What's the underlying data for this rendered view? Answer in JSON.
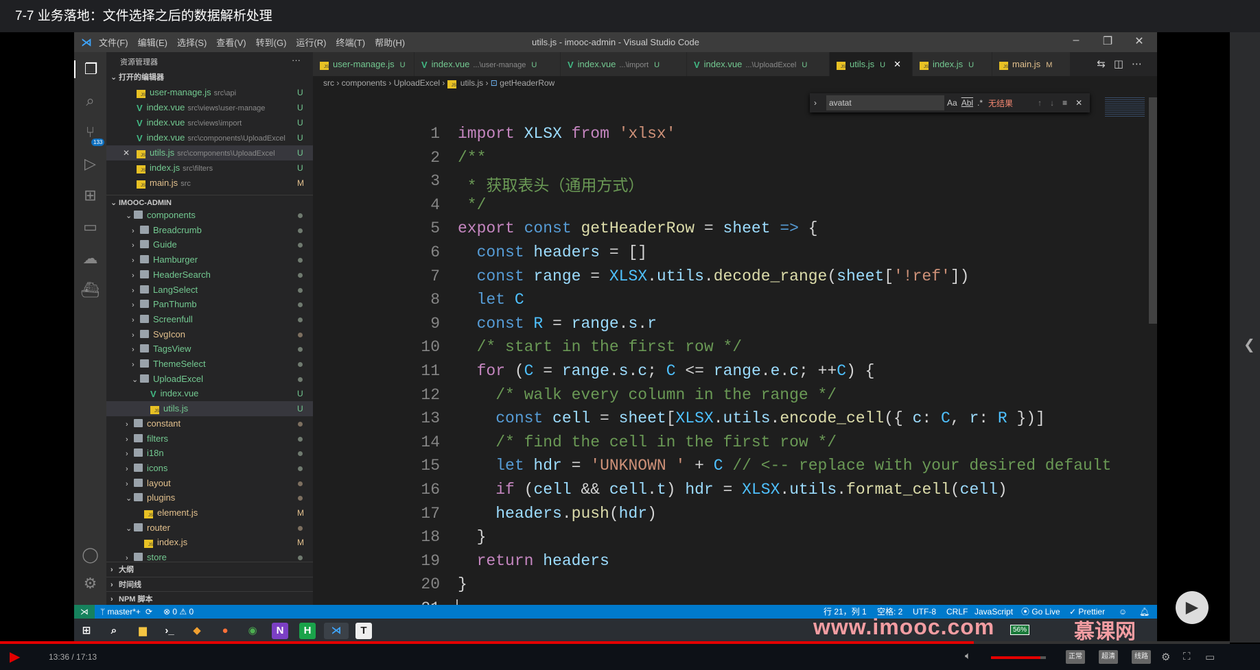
{
  "page_title": "7-7 业务落地：文件选择之后的数据解析处理",
  "window": {
    "title": "utils.js - imooc-admin - Visual Studio Code",
    "menu": [
      "文件(F)",
      "编辑(E)",
      "选择(S)",
      "查看(V)",
      "转到(G)",
      "运行(R)",
      "终端(T)",
      "帮助(H)"
    ],
    "minimize": "–",
    "restore": "❐",
    "close": "✕"
  },
  "activity": {
    "scm_badge": "133"
  },
  "sidebar": {
    "title": "资源管理器",
    "more": "···",
    "open_editors_label": "打开的编辑器",
    "open_editors": [
      {
        "name": "user-manage.js",
        "path": "src\\api",
        "status": "U",
        "type": "js"
      },
      {
        "name": "index.vue",
        "path": "src\\views\\user-manage",
        "status": "U",
        "type": "vue"
      },
      {
        "name": "index.vue",
        "path": "src\\views\\import",
        "status": "U",
        "type": "vue"
      },
      {
        "name": "index.vue",
        "path": "src\\components\\UploadExcel",
        "status": "U",
        "type": "vue"
      },
      {
        "name": "utils.js",
        "path": "src\\components\\UploadExcel",
        "status": "U",
        "type": "js",
        "selected": true
      },
      {
        "name": "index.js",
        "path": "src\\filters",
        "status": "U",
        "type": "js"
      },
      {
        "name": "main.js",
        "path": "src",
        "status": "M",
        "type": "js"
      }
    ],
    "project_label": "IMOOC-ADMIN",
    "tree": [
      {
        "name": "components",
        "depth": 0,
        "kind": "folder",
        "open": true
      },
      {
        "name": "Breadcrumb",
        "depth": 1,
        "kind": "folder"
      },
      {
        "name": "Guide",
        "depth": 1,
        "kind": "folder"
      },
      {
        "name": "Hamburger",
        "depth": 1,
        "kind": "folder"
      },
      {
        "name": "HeaderSearch",
        "depth": 1,
        "kind": "folder"
      },
      {
        "name": "LangSelect",
        "depth": 1,
        "kind": "folder"
      },
      {
        "name": "PanThumb",
        "depth": 1,
        "kind": "folder"
      },
      {
        "name": "Screenfull",
        "depth": 1,
        "kind": "folder"
      },
      {
        "name": "SvgIcon",
        "depth": 1,
        "kind": "folder",
        "mod": true
      },
      {
        "name": "TagsView",
        "depth": 1,
        "kind": "folder"
      },
      {
        "name": "ThemeSelect",
        "depth": 1,
        "kind": "folder"
      },
      {
        "name": "UploadExcel",
        "depth": 1,
        "kind": "folder",
        "open": true
      },
      {
        "name": "index.vue",
        "depth": 2,
        "kind": "vue",
        "status": "U"
      },
      {
        "name": "utils.js",
        "depth": 2,
        "kind": "js",
        "status": "U",
        "selected": true
      },
      {
        "name": "constant",
        "depth": 0,
        "kind": "folder",
        "mod": true
      },
      {
        "name": "filters",
        "depth": 0,
        "kind": "folder"
      },
      {
        "name": "i18n",
        "depth": 0,
        "kind": "folder"
      },
      {
        "name": "icons",
        "depth": 0,
        "kind": "folder"
      },
      {
        "name": "layout",
        "depth": 0,
        "kind": "folder",
        "mod": true
      },
      {
        "name": "plugins",
        "depth": 0,
        "kind": "folder",
        "open": true,
        "mod": true
      },
      {
        "name": "element.js",
        "depth": 1,
        "kind": "js",
        "status": "M"
      },
      {
        "name": "router",
        "depth": 0,
        "kind": "folder",
        "open": true,
        "mod": true
      },
      {
        "name": "index.js",
        "depth": 1,
        "kind": "js",
        "status": "M"
      },
      {
        "name": "store",
        "depth": 0,
        "kind": "folder"
      }
    ],
    "panels": [
      "大纲",
      "时间线",
      "NPM 脚本"
    ]
  },
  "tabs": [
    {
      "name": "user-manage.js",
      "desc": "",
      "status": "U",
      "type": "js"
    },
    {
      "name": "index.vue",
      "desc": "...\\user-manage",
      "status": "U",
      "type": "vue"
    },
    {
      "name": "index.vue",
      "desc": "...\\import",
      "status": "U",
      "type": "vue"
    },
    {
      "name": "index.vue",
      "desc": "...\\UploadExcel",
      "status": "U",
      "type": "vue"
    },
    {
      "name": "utils.js",
      "desc": "",
      "status": "U",
      "type": "js",
      "active": true
    },
    {
      "name": "index.js",
      "desc": "",
      "status": "U",
      "type": "js"
    },
    {
      "name": "main.js",
      "desc": "",
      "status": "M",
      "type": "js"
    }
  ],
  "breadcrumb": [
    "src",
    "components",
    "UploadExcel",
    "utils.js",
    "getHeaderRow"
  ],
  "find": {
    "value": "avatat",
    "match_case": "Aa",
    "whole_word": "Abl",
    "regex": ".*",
    "result": "无结果"
  },
  "code": [
    [
      [
        "import",
        "kw"
      ],
      [
        " XLSX ",
        "va"
      ],
      [
        "from",
        "kw"
      ],
      [
        " 'xlsx'",
        "s"
      ]
    ],
    [
      [
        "/**",
        "cm"
      ]
    ],
    [
      [
        " * 获取表头（通用方式）",
        "cm"
      ]
    ],
    [
      [
        " */",
        "cm"
      ]
    ],
    [
      [
        "export",
        "kw"
      ],
      [
        " const ",
        "st"
      ],
      [
        "getHeaderRow",
        "fn"
      ],
      [
        " = ",
        "p"
      ],
      [
        "sheet",
        "va"
      ],
      [
        " => ",
        "st"
      ],
      [
        "{",
        "p"
      ]
    ],
    [
      [
        "  const ",
        "st"
      ],
      [
        "headers",
        "va"
      ],
      [
        " = []",
        "p"
      ]
    ],
    [
      [
        "  const ",
        "st"
      ],
      [
        "range",
        "va"
      ],
      [
        " = ",
        "p"
      ],
      [
        "XLSX",
        "cn"
      ],
      [
        ".",
        "p"
      ],
      [
        "utils",
        "va"
      ],
      [
        ".",
        "p"
      ],
      [
        "decode_range",
        "fn"
      ],
      [
        "(",
        "p"
      ],
      [
        "sheet",
        "va"
      ],
      [
        "[",
        "p"
      ],
      [
        "'!ref'",
        "s"
      ],
      [
        "])",
        "p"
      ]
    ],
    [
      [
        "  let ",
        "st"
      ],
      [
        "C",
        "cn"
      ]
    ],
    [
      [
        "  const ",
        "st"
      ],
      [
        "R",
        "cn"
      ],
      [
        " = ",
        "p"
      ],
      [
        "range",
        "va"
      ],
      [
        ".",
        "p"
      ],
      [
        "s",
        "va"
      ],
      [
        ".",
        "p"
      ],
      [
        "r",
        "va"
      ]
    ],
    [
      [
        "  /* start in the first row */",
        "cm"
      ]
    ],
    [
      [
        "  for",
        "kw"
      ],
      [
        " (",
        "p"
      ],
      [
        "C",
        "cn"
      ],
      [
        " = ",
        "p"
      ],
      [
        "range",
        "va"
      ],
      [
        ".",
        "p"
      ],
      [
        "s",
        "va"
      ],
      [
        ".",
        "p"
      ],
      [
        "c",
        "va"
      ],
      [
        "; ",
        "p"
      ],
      [
        "C",
        "cn"
      ],
      [
        " <= ",
        "p"
      ],
      [
        "range",
        "va"
      ],
      [
        ".",
        "p"
      ],
      [
        "e",
        "va"
      ],
      [
        ".",
        "p"
      ],
      [
        "c",
        "va"
      ],
      [
        "; ++",
        "p"
      ],
      [
        "C",
        "cn"
      ],
      [
        ") {",
        "p"
      ]
    ],
    [
      [
        "    /* walk every column in the range */",
        "cm"
      ]
    ],
    [
      [
        "    const ",
        "st"
      ],
      [
        "cell",
        "va"
      ],
      [
        " = ",
        "p"
      ],
      [
        "sheet",
        "va"
      ],
      [
        "[",
        "p"
      ],
      [
        "XLSX",
        "cn"
      ],
      [
        ".",
        "p"
      ],
      [
        "utils",
        "va"
      ],
      [
        ".",
        "p"
      ],
      [
        "encode_cell",
        "fn"
      ],
      [
        "({ ",
        "p"
      ],
      [
        "c",
        "va"
      ],
      [
        ": ",
        "p"
      ],
      [
        "C",
        "cn"
      ],
      [
        ", ",
        "p"
      ],
      [
        "r",
        "va"
      ],
      [
        ": ",
        "p"
      ],
      [
        "R",
        "cn"
      ],
      [
        " })]",
        "p"
      ]
    ],
    [
      [
        "    /* find the cell in the first row */",
        "cm"
      ]
    ],
    [
      [
        "    let ",
        "st"
      ],
      [
        "hdr",
        "va"
      ],
      [
        " = ",
        "p"
      ],
      [
        "'UNKNOWN '",
        "s"
      ],
      [
        " + ",
        "p"
      ],
      [
        "C",
        "cn"
      ],
      [
        " // <-- replace with your desired default",
        "cm"
      ]
    ],
    [
      [
        "    if",
        "kw"
      ],
      [
        " (",
        "p"
      ],
      [
        "cell",
        "va"
      ],
      [
        " && ",
        "p"
      ],
      [
        "cell",
        "va"
      ],
      [
        ".",
        "p"
      ],
      [
        "t",
        "va"
      ],
      [
        ") ",
        "p"
      ],
      [
        "hdr",
        "va"
      ],
      [
        " = ",
        "p"
      ],
      [
        "XLSX",
        "cn"
      ],
      [
        ".",
        "p"
      ],
      [
        "utils",
        "va"
      ],
      [
        ".",
        "p"
      ],
      [
        "format_cell",
        "fn"
      ],
      [
        "(",
        "p"
      ],
      [
        "cell",
        "va"
      ],
      [
        ")",
        "p"
      ]
    ],
    [
      [
        "    headers",
        "va"
      ],
      [
        ".",
        "p"
      ],
      [
        "push",
        "fn"
      ],
      [
        "(",
        "p"
      ],
      [
        "hdr",
        "va"
      ],
      [
        ")",
        "p"
      ]
    ],
    [
      [
        "  }",
        "p"
      ]
    ],
    [
      [
        "  return",
        "kw"
      ],
      [
        " headers",
        "va"
      ]
    ],
    [
      [
        "}",
        "p"
      ]
    ],
    [
      [
        "",
        "p"
      ]
    ]
  ],
  "cursor_line": 21,
  "statusbar": {
    "branch": "master*+",
    "sync": "⟳",
    "problems": "⊗ 0 ⚠ 0",
    "position": "行 21，列 1",
    "spaces": "空格: 2",
    "encoding": "UTF-8",
    "eol": "CRLF",
    "language": "JavaScript",
    "golive": "Go Live",
    "prettier": "✓ Prettier"
  },
  "taskbar": {
    "battery": "56%"
  },
  "watermark": {
    "url": "www.imooc.com",
    "brand": "慕课网"
  },
  "player": {
    "time": "13:36 / 17:13",
    "progress": 0.792,
    "volume": 0.9,
    "quality_buttons": [
      "正常",
      "超清",
      "线路"
    ]
  }
}
